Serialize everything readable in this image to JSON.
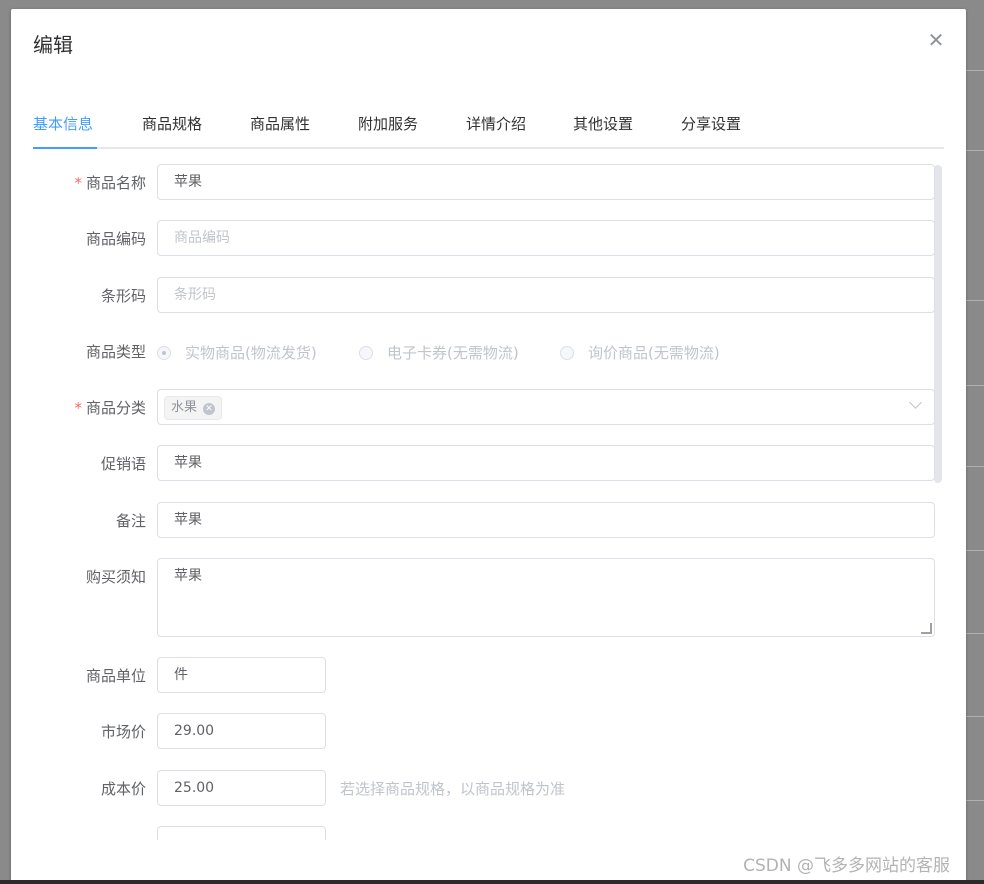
{
  "dialog": {
    "title": "编辑"
  },
  "tabs": [
    {
      "label": "基本信息",
      "active": true
    },
    {
      "label": "商品规格",
      "active": false
    },
    {
      "label": "商品属性",
      "active": false
    },
    {
      "label": "附加服务",
      "active": false
    },
    {
      "label": "详情介绍",
      "active": false
    },
    {
      "label": "其他设置",
      "active": false
    },
    {
      "label": "分享设置",
      "active": false
    }
  ],
  "form": {
    "name": {
      "label": "商品名称",
      "required": true,
      "value": "苹果"
    },
    "code": {
      "label": "商品编码",
      "placeholder": "商品编码"
    },
    "barcode": {
      "label": "条形码",
      "placeholder": "条形码"
    },
    "type": {
      "label": "商品类型",
      "options": [
        "实物商品(物流发货)",
        "电子卡券(无需物流)",
        "询价商品(无需物流)"
      ],
      "selected": "实物商品(物流发货)"
    },
    "category": {
      "label": "商品分类",
      "required": true,
      "tag": "水果"
    },
    "promo": {
      "label": "促销语",
      "value": "苹果"
    },
    "remark": {
      "label": "备注",
      "value": "苹果"
    },
    "notice": {
      "label": "购买须知",
      "value": "苹果"
    },
    "unit": {
      "label": "商品单位",
      "value": "件"
    },
    "market_price": {
      "label": "市场价",
      "value": "29.00"
    },
    "cost_price": {
      "label": "成本价",
      "value": "25.00",
      "hint": "若选择商品规格，以商品规格为准"
    }
  },
  "watermark": "CSDN @飞多多网站的客服",
  "colors": {
    "accent": "#409eff",
    "required": "#f56c6c",
    "border": "#dcdfe6"
  }
}
